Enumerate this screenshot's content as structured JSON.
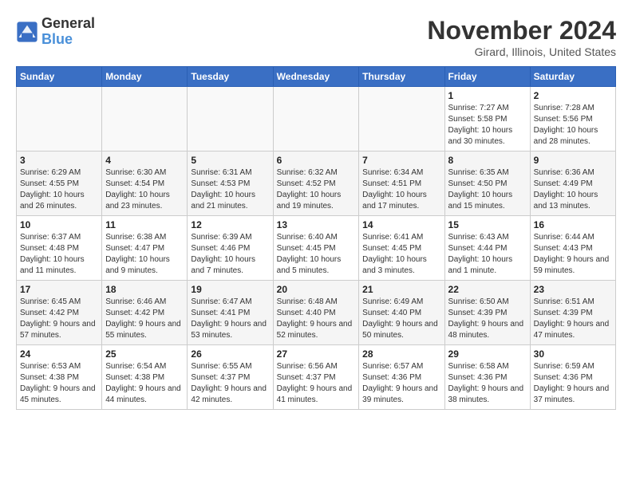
{
  "logo": {
    "text_general": "General",
    "text_blue": "Blue"
  },
  "title": "November 2024",
  "location": "Girard, Illinois, United States",
  "days_of_week": [
    "Sunday",
    "Monday",
    "Tuesday",
    "Wednesday",
    "Thursday",
    "Friday",
    "Saturday"
  ],
  "weeks": [
    [
      {
        "day": "",
        "info": ""
      },
      {
        "day": "",
        "info": ""
      },
      {
        "day": "",
        "info": ""
      },
      {
        "day": "",
        "info": ""
      },
      {
        "day": "",
        "info": ""
      },
      {
        "day": "1",
        "info": "Sunrise: 7:27 AM\nSunset: 5:58 PM\nDaylight: 10 hours and 30 minutes."
      },
      {
        "day": "2",
        "info": "Sunrise: 7:28 AM\nSunset: 5:56 PM\nDaylight: 10 hours and 28 minutes."
      }
    ],
    [
      {
        "day": "3",
        "info": "Sunrise: 6:29 AM\nSunset: 4:55 PM\nDaylight: 10 hours and 26 minutes."
      },
      {
        "day": "4",
        "info": "Sunrise: 6:30 AM\nSunset: 4:54 PM\nDaylight: 10 hours and 23 minutes."
      },
      {
        "day": "5",
        "info": "Sunrise: 6:31 AM\nSunset: 4:53 PM\nDaylight: 10 hours and 21 minutes."
      },
      {
        "day": "6",
        "info": "Sunrise: 6:32 AM\nSunset: 4:52 PM\nDaylight: 10 hours and 19 minutes."
      },
      {
        "day": "7",
        "info": "Sunrise: 6:34 AM\nSunset: 4:51 PM\nDaylight: 10 hours and 17 minutes."
      },
      {
        "day": "8",
        "info": "Sunrise: 6:35 AM\nSunset: 4:50 PM\nDaylight: 10 hours and 15 minutes."
      },
      {
        "day": "9",
        "info": "Sunrise: 6:36 AM\nSunset: 4:49 PM\nDaylight: 10 hours and 13 minutes."
      }
    ],
    [
      {
        "day": "10",
        "info": "Sunrise: 6:37 AM\nSunset: 4:48 PM\nDaylight: 10 hours and 11 minutes."
      },
      {
        "day": "11",
        "info": "Sunrise: 6:38 AM\nSunset: 4:47 PM\nDaylight: 10 hours and 9 minutes."
      },
      {
        "day": "12",
        "info": "Sunrise: 6:39 AM\nSunset: 4:46 PM\nDaylight: 10 hours and 7 minutes."
      },
      {
        "day": "13",
        "info": "Sunrise: 6:40 AM\nSunset: 4:45 PM\nDaylight: 10 hours and 5 minutes."
      },
      {
        "day": "14",
        "info": "Sunrise: 6:41 AM\nSunset: 4:45 PM\nDaylight: 10 hours and 3 minutes."
      },
      {
        "day": "15",
        "info": "Sunrise: 6:43 AM\nSunset: 4:44 PM\nDaylight: 10 hours and 1 minute."
      },
      {
        "day": "16",
        "info": "Sunrise: 6:44 AM\nSunset: 4:43 PM\nDaylight: 9 hours and 59 minutes."
      }
    ],
    [
      {
        "day": "17",
        "info": "Sunrise: 6:45 AM\nSunset: 4:42 PM\nDaylight: 9 hours and 57 minutes."
      },
      {
        "day": "18",
        "info": "Sunrise: 6:46 AM\nSunset: 4:42 PM\nDaylight: 9 hours and 55 minutes."
      },
      {
        "day": "19",
        "info": "Sunrise: 6:47 AM\nSunset: 4:41 PM\nDaylight: 9 hours and 53 minutes."
      },
      {
        "day": "20",
        "info": "Sunrise: 6:48 AM\nSunset: 4:40 PM\nDaylight: 9 hours and 52 minutes."
      },
      {
        "day": "21",
        "info": "Sunrise: 6:49 AM\nSunset: 4:40 PM\nDaylight: 9 hours and 50 minutes."
      },
      {
        "day": "22",
        "info": "Sunrise: 6:50 AM\nSunset: 4:39 PM\nDaylight: 9 hours and 48 minutes."
      },
      {
        "day": "23",
        "info": "Sunrise: 6:51 AM\nSunset: 4:39 PM\nDaylight: 9 hours and 47 minutes."
      }
    ],
    [
      {
        "day": "24",
        "info": "Sunrise: 6:53 AM\nSunset: 4:38 PM\nDaylight: 9 hours and 45 minutes."
      },
      {
        "day": "25",
        "info": "Sunrise: 6:54 AM\nSunset: 4:38 PM\nDaylight: 9 hours and 44 minutes."
      },
      {
        "day": "26",
        "info": "Sunrise: 6:55 AM\nSunset: 4:37 PM\nDaylight: 9 hours and 42 minutes."
      },
      {
        "day": "27",
        "info": "Sunrise: 6:56 AM\nSunset: 4:37 PM\nDaylight: 9 hours and 41 minutes."
      },
      {
        "day": "28",
        "info": "Sunrise: 6:57 AM\nSunset: 4:36 PM\nDaylight: 9 hours and 39 minutes."
      },
      {
        "day": "29",
        "info": "Sunrise: 6:58 AM\nSunset: 4:36 PM\nDaylight: 9 hours and 38 minutes."
      },
      {
        "day": "30",
        "info": "Sunrise: 6:59 AM\nSunset: 4:36 PM\nDaylight: 9 hours and 37 minutes."
      }
    ]
  ]
}
